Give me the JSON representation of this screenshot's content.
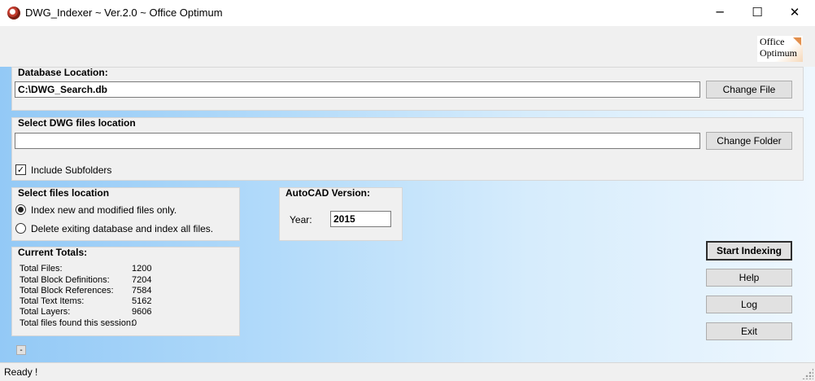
{
  "window": {
    "title": "DWG_Indexer ~ Ver.2.0 ~ Office Optimum",
    "controls": {
      "minimize": "─",
      "maximize": "☐",
      "close": "✕"
    }
  },
  "logo": {
    "line1": "Office",
    "line2": "Optimum"
  },
  "database": {
    "legend": "Database Location:",
    "path": "C:\\DWG_Search.db",
    "button": "Change File"
  },
  "dwg_location": {
    "legend": "Select DWG files location",
    "path": "",
    "button": "Change Folder",
    "include_subfolders_label": "Include Subfolders",
    "include_subfolders_checked": true
  },
  "files_location": {
    "legend": "Select files location",
    "options": [
      {
        "label": "Index new and modified files only.",
        "selected": true
      },
      {
        "label": "Delete exiting database and index all files.",
        "selected": false
      }
    ]
  },
  "autocad": {
    "legend": "AutoCAD Version:",
    "year_label": "Year:",
    "year_value": "2015"
  },
  "totals": {
    "legend": "Current Totals:",
    "rows": [
      {
        "label": "Total Files:",
        "value": "1200"
      },
      {
        "label": "Total Block Definitions:",
        "value": "7204"
      },
      {
        "label": "Total Block References:",
        "value": "7584"
      },
      {
        "label": "Total Text Items:",
        "value": "5162"
      },
      {
        "label": "Total Layers:",
        "value": "9606"
      },
      {
        "label": "Total files found this session:",
        "value": "0"
      }
    ]
  },
  "actions": {
    "start": "Start Indexing",
    "help": "Help",
    "log": "Log",
    "exit": "Exit"
  },
  "small_button": "-",
  "status": "Ready !"
}
